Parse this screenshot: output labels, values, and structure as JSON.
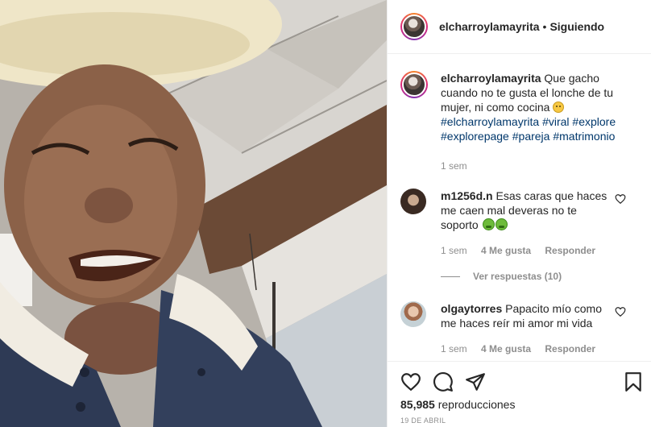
{
  "post": {
    "username": "elcharroylamayrita",
    "separator": "•",
    "follow_status": "Siguiendo"
  },
  "caption": {
    "username": "elcharroylamayrita",
    "text": "Que gacho cuando no te gusta el lonche de tu mujer, ni como cocina",
    "emoji": "sad-face-emoji",
    "hashtags": [
      "#elcharroylamayrita",
      "#viral",
      "#explore",
      "#explorepage",
      "#pareja",
      "#matrimonio"
    ],
    "time": "1 sem"
  },
  "comments": [
    {
      "username": "m1256d.n",
      "text": "Esas caras que haces me caen mal deveras no te soporto",
      "emoji": [
        "nauseated-face-emoji",
        "nauseated-face-emoji"
      ],
      "time": "1 sem",
      "likes": "4 Me gusta",
      "reply": "Responder",
      "view_replies": "Ver respuestas (10)"
    },
    {
      "username": "olgaytorres",
      "text": "Papacito mío como me haces reír mi amor mi vida",
      "time": "1 sem",
      "likes": "4 Me gusta",
      "reply": "Responder"
    }
  ],
  "stats": {
    "views_number": "85,985",
    "views_label": "reproducciones",
    "date": "19 DE ABRIL"
  },
  "icons": {
    "like": "heart-icon",
    "comment": "comment-icon",
    "share": "send-icon",
    "save": "bookmark-icon"
  }
}
